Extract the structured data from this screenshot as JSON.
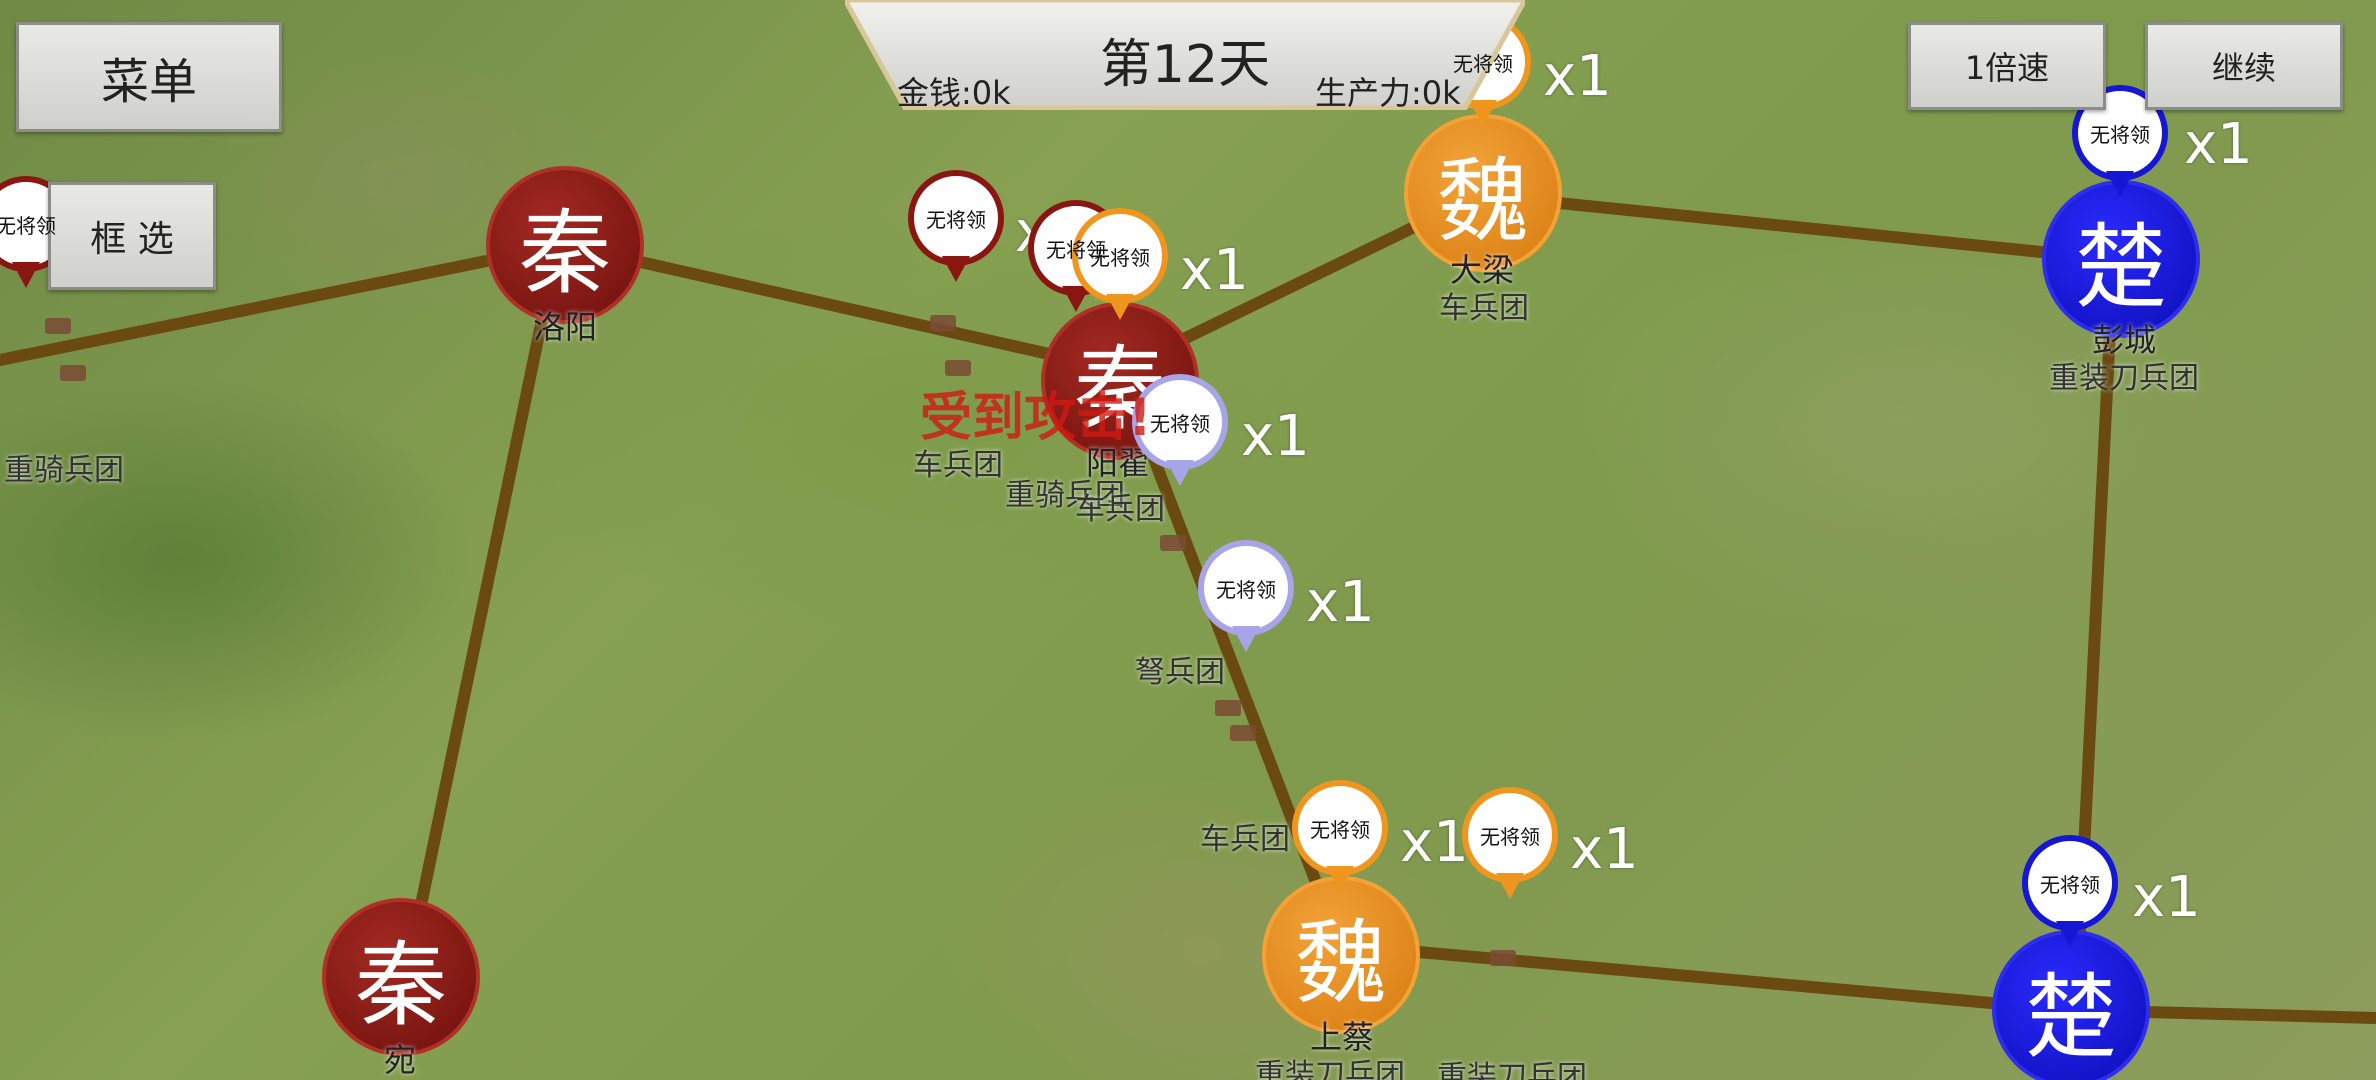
{
  "hud": {
    "day": "第12天",
    "money": "金钱:0k",
    "production": "生产力:0k",
    "menu_button": "菜单",
    "box_select_button": "框 选",
    "speed_button": "1倍速",
    "continue_button": "继续"
  },
  "colors": {
    "qin": "#8a1612",
    "wei": "#f0961e",
    "chu": "#1616d6",
    "road": "#6b4a12",
    "floating_text": "#d11a12"
  },
  "cities": [
    {
      "faction": "秦",
      "name": "洛阳",
      "unit": ""
    },
    {
      "faction": "秦",
      "name": "阳翟",
      "unit": "重骑兵团"
    },
    {
      "faction": "秦",
      "name": "宛",
      "unit": ""
    },
    {
      "faction": "魏",
      "name": "大梁",
      "unit": "车兵团"
    },
    {
      "faction": "魏",
      "name": "上蔡",
      "unit": "重装刀兵团"
    },
    {
      "faction": "楚",
      "name": "彭城",
      "unit": "重装刀兵团"
    },
    {
      "faction": "楚",
      "name": "",
      "unit": ""
    }
  ],
  "armies": [
    {
      "general": "无将领",
      "count": "x1",
      "unit": "重骑兵团"
    },
    {
      "general": "无将领",
      "count": "x1",
      "unit": "车兵团"
    },
    {
      "general": "无将领",
      "count": "x1",
      "unit": ""
    },
    {
      "general": "无将领",
      "count": "x1",
      "unit": "车兵团"
    },
    {
      "general": "无将领",
      "count": "x1",
      "unit": ""
    },
    {
      "general": "无将领",
      "count": "x1",
      "unit": "车兵团"
    },
    {
      "general": "无将领",
      "count": "x1",
      "unit": "弩兵团"
    },
    {
      "general": "无将领",
      "count": "x1",
      "unit": "车兵团"
    },
    {
      "general": "无将领",
      "count": "x1",
      "unit": "重装刀兵团"
    },
    {
      "general": "无将领",
      "count": "x1",
      "unit": ""
    },
    {
      "general": "无将领",
      "count": "x1",
      "unit": ""
    }
  ],
  "floating_text": "受到攻击!"
}
